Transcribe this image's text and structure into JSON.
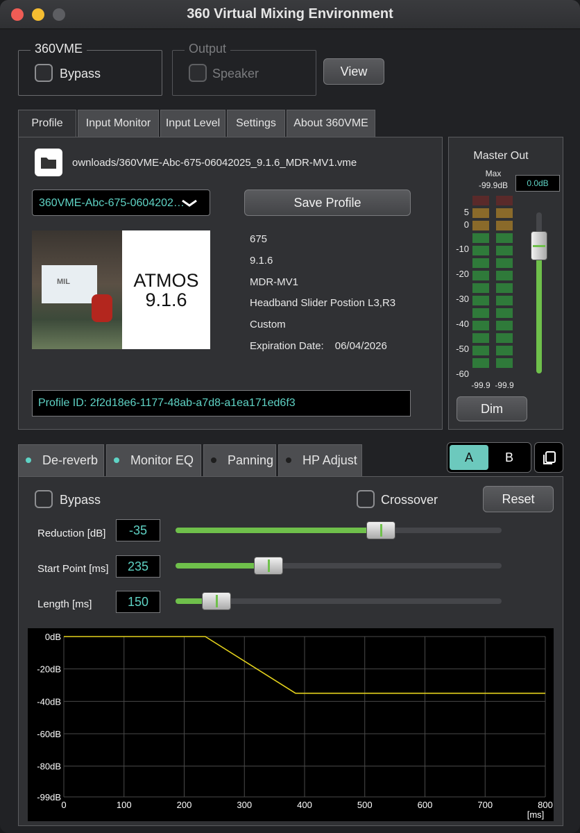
{
  "window": {
    "title": "360 Virtual Mixing Environment"
  },
  "vme_group": {
    "legend": "360VME",
    "bypass_label": "Bypass",
    "bypass_checked": false
  },
  "output_group": {
    "legend": "Output",
    "speaker_label": "Speaker",
    "speaker_checked": false,
    "enabled": false
  },
  "view_button": "View",
  "top_tabs": [
    "Profile",
    "Input Monitor",
    "Input Level",
    "Settings",
    "About 360VME"
  ],
  "active_top_tab": "Profile",
  "profile": {
    "file_path": "ownloads/360VME-Abc-675-06042025_9.1.6_MDR-MV1.vme",
    "selected_profile": "360VME-Abc-675-0604202…",
    "save_button": "Save Profile",
    "image": {
      "logo_text": "MIL",
      "format_line1": "ATMOS",
      "format_line2": "9.1.6"
    },
    "details": [
      "675",
      "9.1.6",
      "MDR-MV1",
      "Headband Slider Postion L3,R3",
      "Custom"
    ],
    "expiration_label": "Expiration Date:",
    "expiration_value": "06/04/2026",
    "profile_id": "Profile ID: 2f2d18e6-1177-48ab-a7d8-a1ea171ed6f3"
  },
  "master_out": {
    "title": "Master Out",
    "max_label": "Max",
    "max_value": "-99.9dB",
    "gain_value": "0.0dB",
    "scale": [
      "5",
      "0",
      "-10",
      "-20",
      "-30",
      "-40",
      "-50",
      "-60"
    ],
    "left_level": "-99.9",
    "right_level": "-99.9",
    "fader_level_db": 0.0,
    "dim_button": "Dim"
  },
  "effect_tabs": [
    {
      "label": "De-reverb",
      "on": true
    },
    {
      "label": "Monitor EQ",
      "on": true
    },
    {
      "label": "Panning",
      "on": false
    },
    {
      "label": "HP Adjust",
      "on": false
    }
  ],
  "ab": {
    "a": "A",
    "b": "B",
    "selected": "A"
  },
  "dereverb": {
    "bypass_label": "Bypass",
    "crossover_label": "Crossover",
    "reset_button": "Reset",
    "sliders": [
      {
        "label": "Reduction [dB]",
        "value": "-35",
        "fraction": 0.63
      },
      {
        "label": "Start Point [ms]",
        "value": "235",
        "fraction": 0.285
      },
      {
        "label": "Length [ms]",
        "value": "150",
        "fraction": 0.125
      }
    ]
  },
  "chart_data": {
    "type": "line",
    "x": [
      0,
      235,
      385,
      800
    ],
    "y": [
      0,
      0,
      -35,
      -35
    ],
    "xlim": [
      0,
      800
    ],
    "ylim": [
      -99,
      0
    ],
    "x_ticks": [
      0,
      100,
      200,
      300,
      400,
      500,
      600,
      700,
      800
    ],
    "y_tick_labels": [
      "0dB",
      "-20dB",
      "-40dB",
      "-60dB",
      "-80dB",
      "-99dB"
    ],
    "y_tick_values": [
      0,
      -20,
      -40,
      -60,
      -80,
      -99
    ],
    "x_unit": "[ms]",
    "grid": true,
    "line_color": "#e5d31c"
  },
  "colors": {
    "accent": "#5fd3c5",
    "meter_green": "#2f7a3a",
    "meter_amber": "#8a6a2a",
    "meter_red": "#5a2a2a",
    "slider_green": "#6fc04b"
  }
}
